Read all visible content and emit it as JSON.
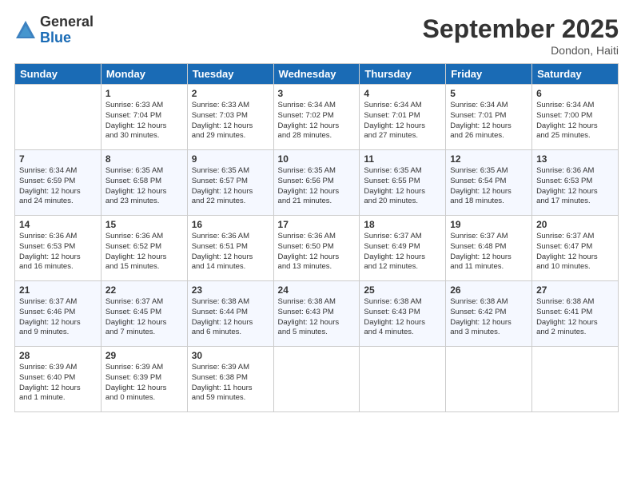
{
  "logo": {
    "general": "General",
    "blue": "Blue"
  },
  "header": {
    "month": "September 2025",
    "location": "Dondon, Haiti"
  },
  "weekdays": [
    "Sunday",
    "Monday",
    "Tuesday",
    "Wednesday",
    "Thursday",
    "Friday",
    "Saturday"
  ],
  "weeks": [
    [
      {
        "day": "",
        "info": ""
      },
      {
        "day": "1",
        "info": "Sunrise: 6:33 AM\nSunset: 7:04 PM\nDaylight: 12 hours\nand 30 minutes."
      },
      {
        "day": "2",
        "info": "Sunrise: 6:33 AM\nSunset: 7:03 PM\nDaylight: 12 hours\nand 29 minutes."
      },
      {
        "day": "3",
        "info": "Sunrise: 6:34 AM\nSunset: 7:02 PM\nDaylight: 12 hours\nand 28 minutes."
      },
      {
        "day": "4",
        "info": "Sunrise: 6:34 AM\nSunset: 7:01 PM\nDaylight: 12 hours\nand 27 minutes."
      },
      {
        "day": "5",
        "info": "Sunrise: 6:34 AM\nSunset: 7:01 PM\nDaylight: 12 hours\nand 26 minutes."
      },
      {
        "day": "6",
        "info": "Sunrise: 6:34 AM\nSunset: 7:00 PM\nDaylight: 12 hours\nand 25 minutes."
      }
    ],
    [
      {
        "day": "7",
        "info": "Sunrise: 6:34 AM\nSunset: 6:59 PM\nDaylight: 12 hours\nand 24 minutes."
      },
      {
        "day": "8",
        "info": "Sunrise: 6:35 AM\nSunset: 6:58 PM\nDaylight: 12 hours\nand 23 minutes."
      },
      {
        "day": "9",
        "info": "Sunrise: 6:35 AM\nSunset: 6:57 PM\nDaylight: 12 hours\nand 22 minutes."
      },
      {
        "day": "10",
        "info": "Sunrise: 6:35 AM\nSunset: 6:56 PM\nDaylight: 12 hours\nand 21 minutes."
      },
      {
        "day": "11",
        "info": "Sunrise: 6:35 AM\nSunset: 6:55 PM\nDaylight: 12 hours\nand 20 minutes."
      },
      {
        "day": "12",
        "info": "Sunrise: 6:35 AM\nSunset: 6:54 PM\nDaylight: 12 hours\nand 18 minutes."
      },
      {
        "day": "13",
        "info": "Sunrise: 6:36 AM\nSunset: 6:53 PM\nDaylight: 12 hours\nand 17 minutes."
      }
    ],
    [
      {
        "day": "14",
        "info": "Sunrise: 6:36 AM\nSunset: 6:53 PM\nDaylight: 12 hours\nand 16 minutes."
      },
      {
        "day": "15",
        "info": "Sunrise: 6:36 AM\nSunset: 6:52 PM\nDaylight: 12 hours\nand 15 minutes."
      },
      {
        "day": "16",
        "info": "Sunrise: 6:36 AM\nSunset: 6:51 PM\nDaylight: 12 hours\nand 14 minutes."
      },
      {
        "day": "17",
        "info": "Sunrise: 6:36 AM\nSunset: 6:50 PM\nDaylight: 12 hours\nand 13 minutes."
      },
      {
        "day": "18",
        "info": "Sunrise: 6:37 AM\nSunset: 6:49 PM\nDaylight: 12 hours\nand 12 minutes."
      },
      {
        "day": "19",
        "info": "Sunrise: 6:37 AM\nSunset: 6:48 PM\nDaylight: 12 hours\nand 11 minutes."
      },
      {
        "day": "20",
        "info": "Sunrise: 6:37 AM\nSunset: 6:47 PM\nDaylight: 12 hours\nand 10 minutes."
      }
    ],
    [
      {
        "day": "21",
        "info": "Sunrise: 6:37 AM\nSunset: 6:46 PM\nDaylight: 12 hours\nand 9 minutes."
      },
      {
        "day": "22",
        "info": "Sunrise: 6:37 AM\nSunset: 6:45 PM\nDaylight: 12 hours\nand 7 minutes."
      },
      {
        "day": "23",
        "info": "Sunrise: 6:38 AM\nSunset: 6:44 PM\nDaylight: 12 hours\nand 6 minutes."
      },
      {
        "day": "24",
        "info": "Sunrise: 6:38 AM\nSunset: 6:43 PM\nDaylight: 12 hours\nand 5 minutes."
      },
      {
        "day": "25",
        "info": "Sunrise: 6:38 AM\nSunset: 6:43 PM\nDaylight: 12 hours\nand 4 minutes."
      },
      {
        "day": "26",
        "info": "Sunrise: 6:38 AM\nSunset: 6:42 PM\nDaylight: 12 hours\nand 3 minutes."
      },
      {
        "day": "27",
        "info": "Sunrise: 6:38 AM\nSunset: 6:41 PM\nDaylight: 12 hours\nand 2 minutes."
      }
    ],
    [
      {
        "day": "28",
        "info": "Sunrise: 6:39 AM\nSunset: 6:40 PM\nDaylight: 12 hours\nand 1 minute."
      },
      {
        "day": "29",
        "info": "Sunrise: 6:39 AM\nSunset: 6:39 PM\nDaylight: 12 hours\nand 0 minutes."
      },
      {
        "day": "30",
        "info": "Sunrise: 6:39 AM\nSunset: 6:38 PM\nDaylight: 11 hours\nand 59 minutes."
      },
      {
        "day": "",
        "info": ""
      },
      {
        "day": "",
        "info": ""
      },
      {
        "day": "",
        "info": ""
      },
      {
        "day": "",
        "info": ""
      }
    ]
  ]
}
